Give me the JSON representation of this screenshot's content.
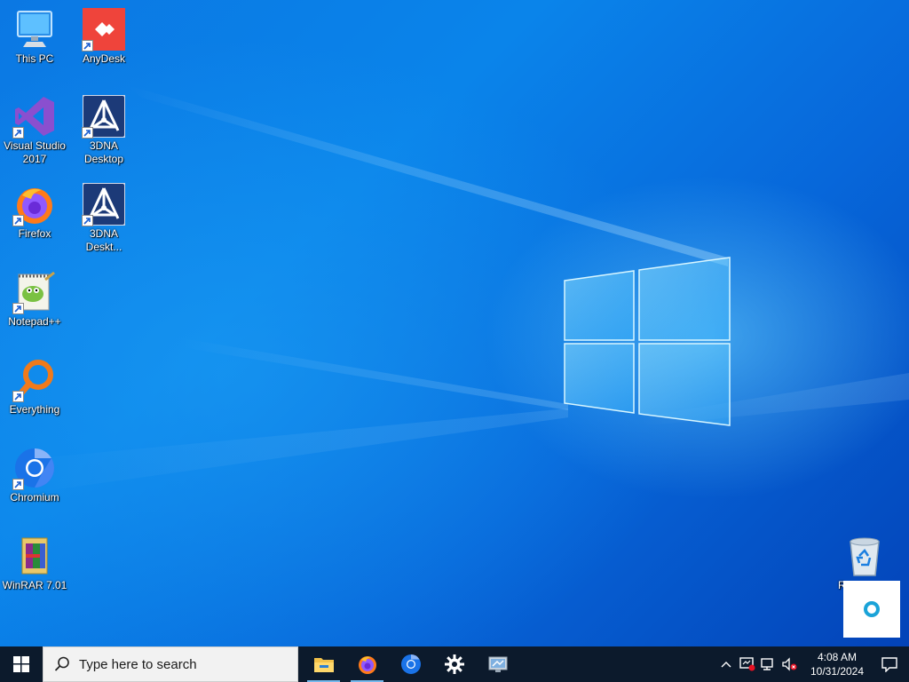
{
  "desktop": {
    "icons": [
      {
        "name": "this-pc",
        "label": "This PC"
      },
      {
        "name": "anydesk",
        "label": "AnyDesk"
      },
      {
        "name": "visual-studio",
        "label": "Visual Studio 2017"
      },
      {
        "name": "3dna-desktop",
        "label": "3DNA Desktop"
      },
      {
        "name": "firefox",
        "label": "Firefox"
      },
      {
        "name": "3dna-desktop-2",
        "label": "3DNA Deskt..."
      },
      {
        "name": "notepadpp",
        "label": "Notepad++"
      },
      {
        "name": "everything",
        "label": "Everything"
      },
      {
        "name": "chromium",
        "label": "Chromium"
      },
      {
        "name": "winrar",
        "label": "WinRAR 7.01"
      },
      {
        "name": "recycle-bin",
        "label": "R"
      }
    ]
  },
  "taskbar": {
    "search_placeholder": "Type here to search",
    "apps": [
      {
        "name": "file-explorer-icon",
        "running": true
      },
      {
        "name": "firefox-icon",
        "running": true
      },
      {
        "name": "chromium-icon",
        "running": false
      },
      {
        "name": "settings-icon",
        "running": false
      },
      {
        "name": "remote-desktop-icon",
        "running": false
      }
    ],
    "clock": {
      "time": "4:08 AM",
      "date": "10/31/2024"
    }
  },
  "colors": {
    "taskbar_bg": "#0c1a2c",
    "accent": "#76b9ed"
  }
}
